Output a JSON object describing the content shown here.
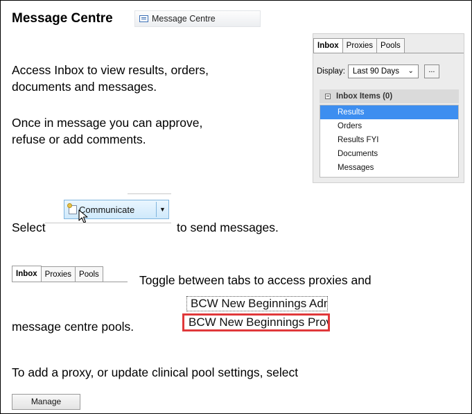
{
  "title": "Message Centre",
  "toolbar_button": {
    "label": "Message Centre",
    "icon": "envelope-icon"
  },
  "paragraphs": {
    "access_inbox": "Access Inbox to view results, orders,",
    "access_inbox_2": "documents and messages.",
    "once_in": "Once in message you can approve,",
    "once_in_2": "refuse or add comments.",
    "select_before": "Select",
    "select_after": "to send messages.",
    "toggle": "Toggle between tabs to access proxies and",
    "pools_text": "message centre pools.",
    "proxy_text": "To add a proxy, or update clinical pool settings, select"
  },
  "inbox_panel": {
    "tabs": [
      "Inbox",
      "Proxies",
      "Pools"
    ],
    "active_tab": "Inbox",
    "display_label": "Display:",
    "display_value": "Last 90 Days",
    "more_label": "...",
    "items_header": "Inbox Items (0)",
    "items": [
      "Results",
      "Orders",
      "Results FYI",
      "Documents",
      "Messages"
    ],
    "selected_item": "Results"
  },
  "communicate_button": {
    "label": "Communicate"
  },
  "tabs_small": [
    "Inbox",
    "Proxies",
    "Pools"
  ],
  "pools": [
    "BCW New Beginnings Admin",
    "BCW New Beginnings Provider"
  ],
  "manage_button": {
    "label": "Manage"
  },
  "colors": {
    "selection": "#3d8ef0",
    "highlight_border": "#e0383a",
    "communicate_bg": "#cfe9fb"
  }
}
